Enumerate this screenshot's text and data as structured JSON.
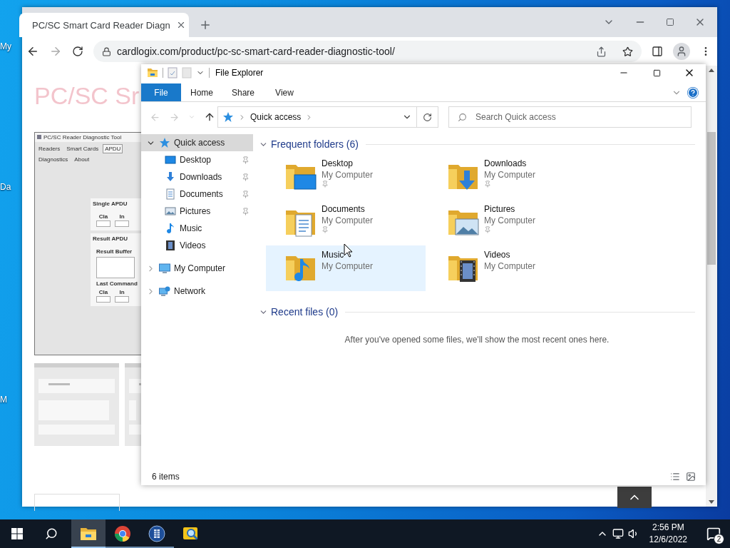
{
  "desktop": {
    "icon_labels": [
      "My",
      "Da",
      "M"
    ]
  },
  "browser": {
    "tabs": [
      {
        "title": "PC/SC Smart Card Reader Diagn",
        "selected": true
      }
    ],
    "address": "cardlogix.com/product/pc-sc-smart-card-reader-diagnostic-tool/",
    "page": {
      "heading": "PC/SC Sr",
      "screenshot": {
        "title": "PC/SC Reader Diagnostic Tool",
        "tabs": [
          {
            "label": "Readers",
            "selected": false
          },
          {
            "label": "Smart Cards",
            "selected": false
          },
          {
            "label": "APDU",
            "selected": true
          },
          {
            "label": "Diagnostics",
            "selected": false
          },
          {
            "label": "About",
            "selected": false
          }
        ],
        "groups": [
          {
            "title": "Single APDU",
            "fields": [
              "Cla",
              "In"
            ]
          },
          {
            "title": "Result APDU",
            "buffer_label": "Result Buffer",
            "last_command_label": "Last Command",
            "fields": [
              "Cla",
              "In"
            ]
          }
        ]
      }
    }
  },
  "explorer": {
    "title": "File Explorer",
    "ribbon_tabs": [
      {
        "label": "File",
        "selected": true
      },
      {
        "label": "Home",
        "selected": false
      },
      {
        "label": "Share",
        "selected": false
      },
      {
        "label": "View",
        "selected": false
      }
    ],
    "breadcrumb": [
      "Quick access"
    ],
    "search": {
      "placeholder": "Search Quick access"
    },
    "nav": [
      {
        "label": "Quick access",
        "kind": "quick",
        "selected": true,
        "expanded": true,
        "children": [
          {
            "label": "Desktop",
            "kind": "desktop",
            "pinned": true
          },
          {
            "label": "Downloads",
            "kind": "downloads",
            "pinned": true
          },
          {
            "label": "Documents",
            "kind": "documents",
            "pinned": true
          },
          {
            "label": "Pictures",
            "kind": "pictures",
            "pinned": true
          },
          {
            "label": "Music",
            "kind": "music",
            "pinned": false
          },
          {
            "label": "Videos",
            "kind": "videos",
            "pinned": false
          }
        ]
      },
      {
        "label": "My Computer",
        "kind": "computer",
        "selected": false,
        "expanded": false
      },
      {
        "label": "Network",
        "kind": "network",
        "selected": false,
        "expanded": false
      }
    ],
    "groups": [
      {
        "title": "Frequent folders (6)",
        "expanded": true,
        "items": [
          {
            "name": "Desktop",
            "location": "My Computer",
            "kind": "desktop",
            "pinned": true,
            "highlighted": false
          },
          {
            "name": "Downloads",
            "location": "My Computer",
            "kind": "downloads",
            "pinned": true,
            "highlighted": false
          },
          {
            "name": "Documents",
            "location": "My Computer",
            "kind": "documents",
            "pinned": true,
            "highlighted": false
          },
          {
            "name": "Pictures",
            "location": "My Computer",
            "kind": "pictures",
            "pinned": true,
            "highlighted": false
          },
          {
            "name": "Music",
            "location": "My Computer",
            "kind": "music",
            "pinned": false,
            "highlighted": true
          },
          {
            "name": "Videos",
            "location": "My Computer",
            "kind": "videos",
            "pinned": false,
            "highlighted": false
          }
        ]
      },
      {
        "title": "Recent files (0)",
        "expanded": true,
        "message": "After you've opened some files, we'll show the most recent ones here."
      }
    ],
    "status": "6 items"
  },
  "taskbar": {
    "apps": [
      {
        "kind": "explorer",
        "active": true,
        "running": true
      },
      {
        "kind": "chrome",
        "active": false,
        "running": true
      },
      {
        "kind": "reader",
        "active": false,
        "running": true
      },
      {
        "kind": "magnifier",
        "active": false,
        "running": false
      }
    ],
    "time": "2:56 PM",
    "date": "12/6/2022",
    "notifications": "2"
  }
}
